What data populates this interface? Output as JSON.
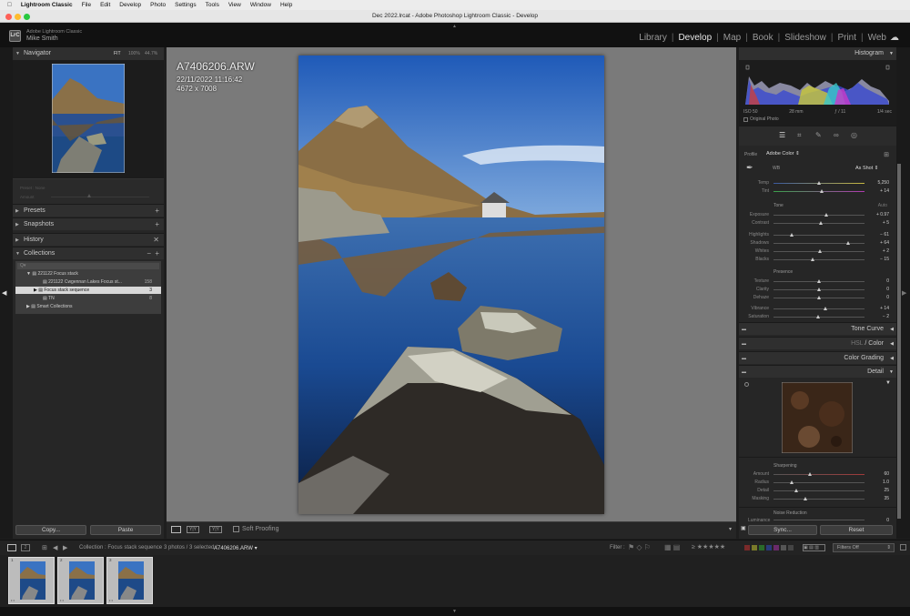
{
  "menubar": {
    "apple": "",
    "app": "Lightroom Classic",
    "items": [
      "File",
      "Edit",
      "Develop",
      "Photo",
      "Settings",
      "Tools",
      "View",
      "Window",
      "Help"
    ]
  },
  "window": {
    "title": "Dec 2022.lrcat - Adobe Photoshop Lightroom Classic - Develop"
  },
  "identity": {
    "logo": "LrC",
    "line1": "Adobe Lightroom Classic",
    "line2": "Mike Smith"
  },
  "modules": [
    "Library",
    "Develop",
    "Map",
    "Book",
    "Slideshow",
    "Print",
    "Web"
  ],
  "left": {
    "navigator": {
      "label": "Navigator",
      "fit": "FIT",
      "z1": "100%",
      "z2": "44.7%"
    },
    "presets": "Presets",
    "snapshots": "Snapshots",
    "history": "History",
    "collections": "Collections",
    "collection_tree": [
      {
        "name": "221122 Focus stack",
        "count": ""
      },
      {
        "name": "221122 Cwgennan Lakes Focus st...",
        "count": "158"
      },
      {
        "name": "Focus stack sequence",
        "count": "3"
      },
      {
        "name": "TN",
        "count": "8"
      },
      {
        "name": "Smart Collections",
        "count": ""
      }
    ],
    "copy": "Copy...",
    "paste": "Paste"
  },
  "photo_info": {
    "filename": "A7406206.ARW",
    "datetime": "22/11/2022 11:16:42",
    "dims": "4672 x 7008"
  },
  "toolbar": {
    "soft_proofing": "Soft Proofing"
  },
  "right": {
    "histogram": "Histogram",
    "hist_info": [
      "ISO 50",
      "28 mm",
      "ƒ / 11",
      "1/4 sec"
    ],
    "original_photo": "Original Photo",
    "profile_label": "Profile",
    "profile_value": "Adobe Color",
    "wb_label": "WB",
    "wb_value": "As Shot",
    "temp": {
      "label": "Temp",
      "value": "5,250",
      "pos": 0.5
    },
    "tint": {
      "label": "Tint",
      "value": "+ 14",
      "pos": 0.53
    },
    "tone": "Tone",
    "tone_auto": "Auto",
    "tone_sliders": [
      {
        "label": "Exposure",
        "value": "+ 0.97",
        "pos": 0.58
      },
      {
        "label": "Contrast",
        "value": "+ 5",
        "pos": 0.52
      }
    ],
    "tone_sliders2": [
      {
        "label": "Highlights",
        "value": "− 61",
        "pos": 0.2
      },
      {
        "label": "Shadows",
        "value": "+ 64",
        "pos": 0.82
      },
      {
        "label": "Whites",
        "value": "+ 2",
        "pos": 0.51
      },
      {
        "label": "Blacks",
        "value": "− 15",
        "pos": 0.43
      }
    ],
    "presence": "Presence",
    "presence_sliders": [
      {
        "label": "Texture",
        "value": "0",
        "pos": 0.5
      },
      {
        "label": "Clarity",
        "value": "0",
        "pos": 0.5
      },
      {
        "label": "Dehaze",
        "value": "0",
        "pos": 0.5
      }
    ],
    "presence_sliders2": [
      {
        "label": "Vibrance",
        "value": "+ 14",
        "pos": 0.57
      },
      {
        "label": "Saturation",
        "value": "− 2",
        "pos": 0.49
      }
    ],
    "tone_curve": "Tone Curve",
    "hsl": "HSL",
    "color": "Color",
    "color_grading": "Color Grading",
    "detail": "Detail",
    "sharpening": "Sharpening",
    "sharp_sliders": [
      {
        "label": "Amount",
        "value": "60",
        "pos": 0.4
      },
      {
        "label": "Radius",
        "value": "1.0",
        "pos": 0.2
      },
      {
        "label": "Detail",
        "value": "25",
        "pos": 0.25
      },
      {
        "label": "Masking",
        "value": "35",
        "pos": 0.35
      }
    ],
    "noise_reduction": "Noise Reduction",
    "luminance": "Luminance",
    "lum_value": "0",
    "sync": "Sync...",
    "reset": "Reset"
  },
  "filmstrip_bar": {
    "path": "Collection : Focus stack sequence",
    "count": "3 photos / 3 selected /",
    "file": "A7406206.ARW",
    "filter": "Filter :",
    "filters_off": "Filters Off"
  },
  "thumbs": [
    "1",
    "2",
    "3"
  ]
}
